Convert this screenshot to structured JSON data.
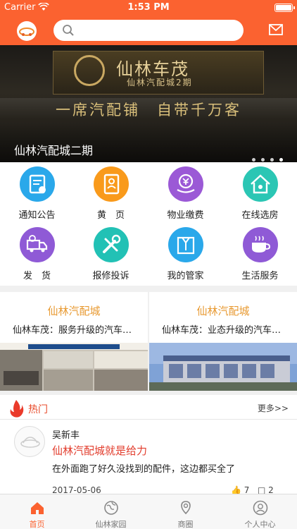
{
  "status_bar": {
    "carrier": "Carrier",
    "time": "1:53 PM"
  },
  "header": {
    "search": {
      "placeholder": "",
      "value": ""
    },
    "logo": "logo-icon",
    "mail_icon": "mail-icon"
  },
  "banner": {
    "brand": "仙林车茂",
    "brand_sub": "仙林汽配城2期",
    "slogan": "一席汽配铺　自带千万客",
    "caption": "仙林汽配城二期",
    "dots": 4
  },
  "menu": {
    "items": [
      {
        "label": "通知公告",
        "color": "#2aa8ea",
        "icon": "notice-icon"
      },
      {
        "label": "黄　页",
        "color": "#f99a1b",
        "icon": "yellow-pages-icon"
      },
      {
        "label": "物业缴费",
        "color": "#9b59d6",
        "icon": "payment-icon"
      },
      {
        "label": "在线选房",
        "color": "#2bc6b4",
        "icon": "house-icon"
      },
      {
        "label": "发　货",
        "color": "#8f5ad6",
        "icon": "truck-icon"
      },
      {
        "label": "报修投诉",
        "color": "#22c1b5",
        "icon": "repair-icon"
      },
      {
        "label": "我的管家",
        "color": "#2aa8ea",
        "icon": "butler-icon"
      },
      {
        "label": "生活服务",
        "color": "#8f5ad6",
        "icon": "coffee-icon"
      }
    ]
  },
  "cards": [
    {
      "title": "仙林汽配城",
      "desc": "仙林车茂：服务升级的汽车…"
    },
    {
      "title": "仙林汽配城",
      "desc": "仙林车茂：业态升级的汽车…"
    }
  ],
  "hot": {
    "title": "热门",
    "more": "更多>>",
    "post": {
      "author": "吴新丰",
      "title": "仙林汽配城就是给力",
      "body": "在外面跑了好久没找到的配件，这边都买全了",
      "date": "2017-05-06",
      "likes": "7",
      "comments": "2"
    }
  },
  "tabbar": {
    "tabs": [
      {
        "label": "首页",
        "icon": "home-icon",
        "active": true
      },
      {
        "label": "仙林家园",
        "icon": "globe-icon",
        "active": false
      },
      {
        "label": "商圈",
        "icon": "location-icon",
        "active": false
      },
      {
        "label": "个人中心",
        "icon": "person-icon",
        "active": false
      }
    ]
  },
  "colors": {
    "brand": "#fb6230",
    "accent_gold": "#e89a32",
    "hot_red": "#e23c2c"
  }
}
